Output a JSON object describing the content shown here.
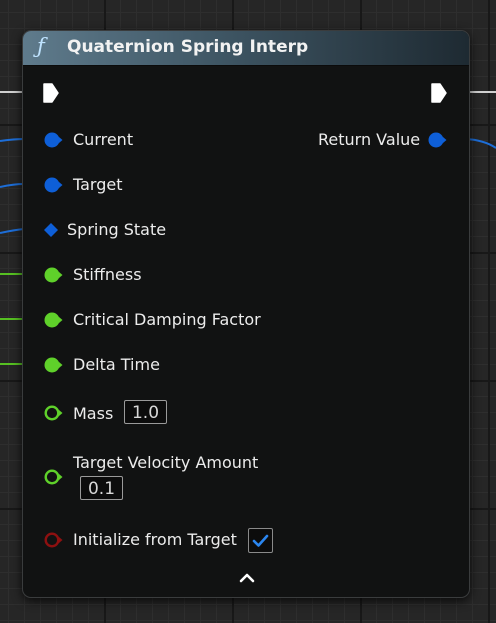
{
  "node": {
    "title": "Quaternion Spring Interp",
    "icon": "function-icon",
    "inputs": [
      {
        "label": "Current",
        "type": "struct-pin",
        "color": "#0e5fd8",
        "connected": true
      },
      {
        "label": "Target",
        "type": "struct-pin",
        "color": "#0e5fd8",
        "connected": true
      },
      {
        "label": "Spring State",
        "type": "reference-pin",
        "color": "#0e5fd8",
        "connected": true
      },
      {
        "label": "Stiffness",
        "type": "float-pin",
        "color": "#5fd12a",
        "connected": true
      },
      {
        "label": "Critical Damping Factor",
        "type": "float-pin",
        "color": "#5fd12a",
        "connected": true
      },
      {
        "label": "Delta Time",
        "type": "float-pin",
        "color": "#5fd12a",
        "connected": true
      },
      {
        "label": "Mass",
        "type": "float-pin",
        "color": "#5fd12a",
        "connected": false,
        "value": "1.0"
      },
      {
        "label": "Target Velocity Amount",
        "type": "float-pin",
        "color": "#5fd12a",
        "connected": false,
        "value": "0.1"
      },
      {
        "label": "Initialize from Target",
        "type": "bool-pin",
        "color": "#8e1010",
        "connected": false,
        "checked": true
      }
    ],
    "outputs": [
      {
        "label": "Return Value",
        "type": "struct-pin",
        "color": "#0e5fd8",
        "connected": true
      }
    ],
    "collapse_icon": "chevron-up-icon"
  }
}
